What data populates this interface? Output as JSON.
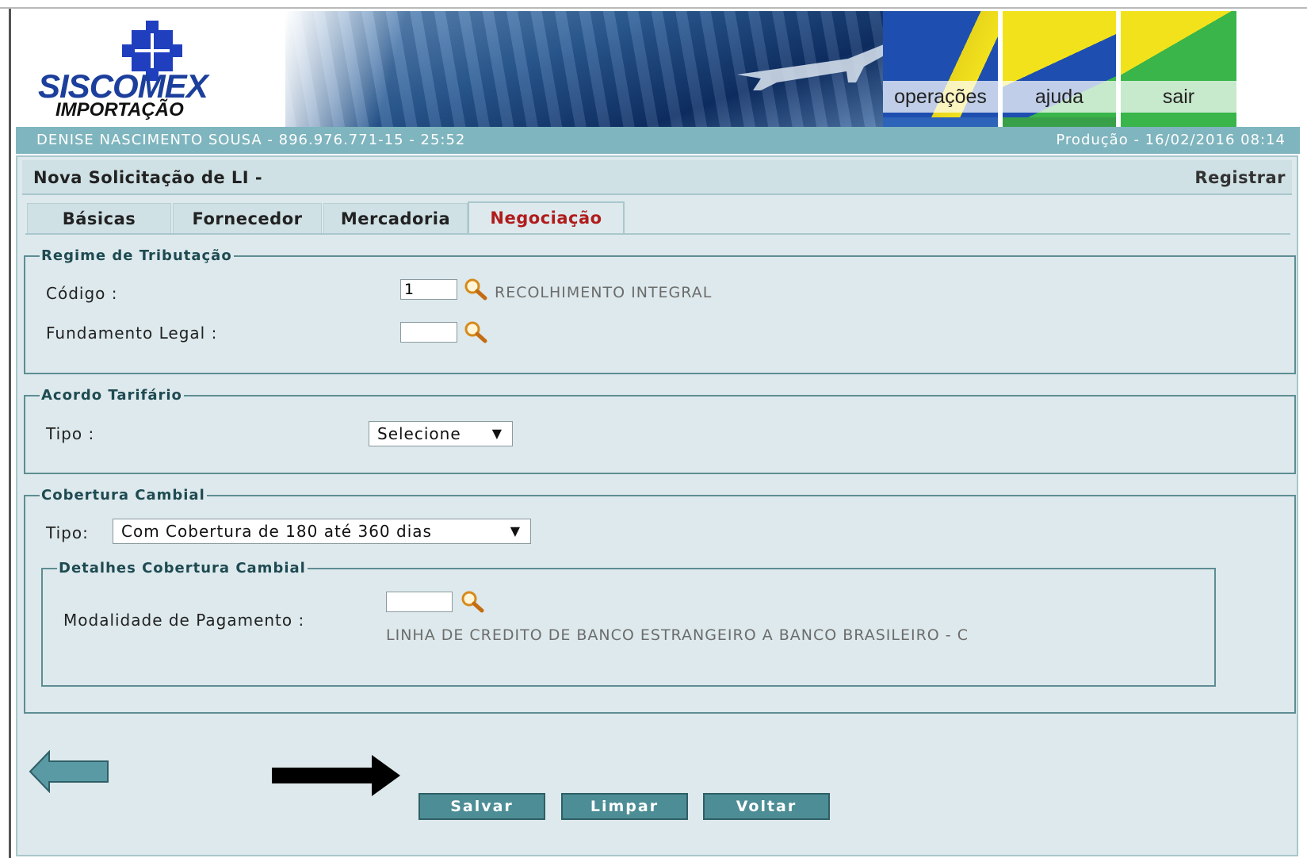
{
  "logo": {
    "title": "SISCOMEX",
    "subtitle": "IMPORTAÇÃO"
  },
  "nav": [
    {
      "label": "operações"
    },
    {
      "label": "ajuda"
    },
    {
      "label": "sair"
    }
  ],
  "userbar": {
    "user": "DENISE NASCIMENTO SOUSA - 896.976.771-15 - 25:52",
    "env": "Produção - 16/02/2016 08:14"
  },
  "page": {
    "title": "Nova Solicitação de LI -",
    "action": "Registrar"
  },
  "tabs": [
    {
      "label": "Básicas"
    },
    {
      "label": "Fornecedor"
    },
    {
      "label": "Mercadoria"
    },
    {
      "label": "Negociação"
    }
  ],
  "regime": {
    "legend": "Regime de Tributação",
    "codigo_label": "Código :",
    "codigo_value": "1",
    "codigo_desc": "RECOLHIMENTO INTEGRAL",
    "fundamento_label": "Fundamento Legal :",
    "fundamento_value": ""
  },
  "acordo": {
    "legend": "Acordo Tarifário",
    "tipo_label": "Tipo :",
    "tipo_value": "Selecione"
  },
  "cobertura": {
    "legend": "Cobertura Cambial",
    "tipo_label": "Tipo:",
    "tipo_value": "Com Cobertura de 180 até 360 dias",
    "detalhes_legend": "Detalhes Cobertura Cambial",
    "modalidade_label": "Modalidade de Pagamento :",
    "modalidade_value": "",
    "modalidade_desc": "LINHA DE CREDITO DE BANCO ESTRANGEIRO A BANCO BRASILEIRO - C"
  },
  "buttons": {
    "save": "Salvar",
    "clear": "Limpar",
    "back": "Voltar"
  },
  "icons": [
    "cross-logo-icon",
    "magnifier-icon",
    "back-arrow-icon",
    "pointer-arrow-icon",
    "dropdown-arrow-icon"
  ]
}
